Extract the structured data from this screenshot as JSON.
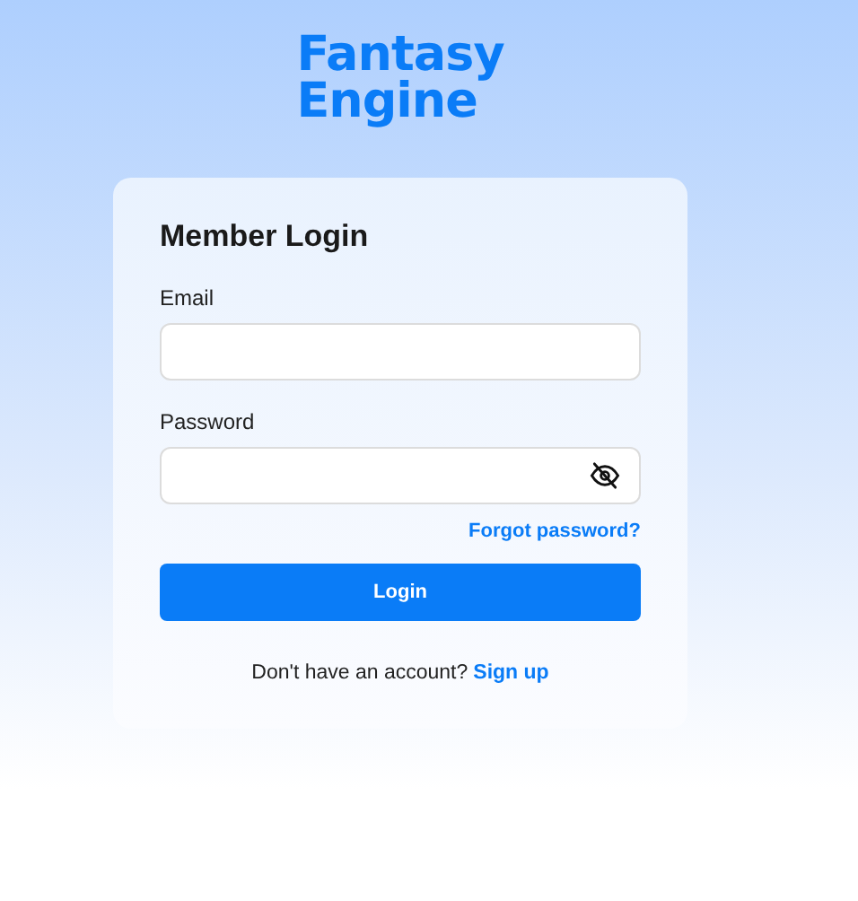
{
  "logo": {
    "lines": [
      "Fantasy",
      "Engine"
    ]
  },
  "login": {
    "title": "Member Login",
    "fields": [
      {
        "label": "Email",
        "kind": "text"
      },
      {
        "label": "Password",
        "kind": "password",
        "password_visible": false
      }
    ],
    "forgot_link": "Forgot password?",
    "submit_button": "Login",
    "signup_prompt": "Don't have an account?",
    "signup_link": "Sign up"
  }
}
